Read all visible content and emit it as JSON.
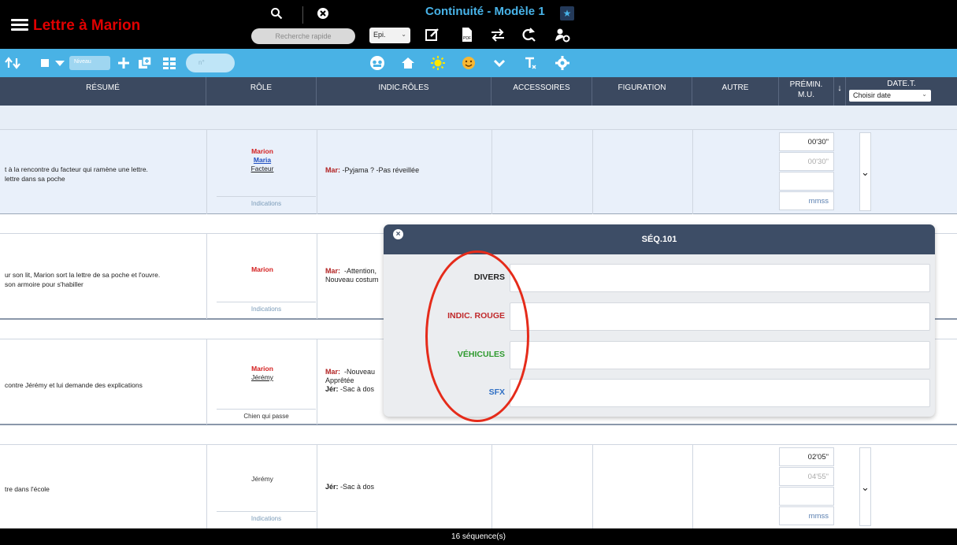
{
  "app": {
    "title": "Lettre à Marion",
    "model_title": "Continuité - Modèle 1",
    "search_placeholder": "Recherche rapide",
    "episode_select": "Epi.",
    "star_label": "★"
  },
  "toolbar2": {
    "level_label": "Niveau",
    "num_field": "n°"
  },
  "columns": {
    "resume": "RÉSUMÉ",
    "role": "RÔLE",
    "indic_roles": "INDIC.RÔLES",
    "accessoires": "ACCESSOIRES",
    "figuration": "FIGURATION",
    "autre": "AUTRE",
    "premin_line1": "PRÉMIN.",
    "premin_line2": "M.U.",
    "sort_arrow": "↓",
    "date_t": "DATE.T.",
    "date_select": "Choisir date"
  },
  "rows": [
    {
      "resume_line1": "t à la rencontre du facteur qui ramène une lettre.",
      "resume_line2": "lettre dans sa poche",
      "role1": "Marion",
      "role2": "Maria",
      "role3": "Facteur",
      "indic_label": "Mar:",
      "indic_text": "-Pyjama ? -Pas réveillée",
      "role_footer": "Indications",
      "time1": "00'30\"",
      "time2": "00'30\"",
      "time3": "mmss"
    },
    {
      "resume_line1": "ur son lit, Marion sort la lettre de sa poche et l'ouvre.",
      "resume_line2": "son armoire pour s'habiller",
      "role1": "Marion",
      "indic_label": "Mar:",
      "indic_text": "-Attention,",
      "indic_line2": "Nouveau costum",
      "role_footer": "Indications"
    },
    {
      "resume_line1": "contre Jérémy et lui demande des explications",
      "role1": "Marion",
      "role2": "Jérémy",
      "indic_label": "Mar:",
      "indic_text": "-Nouveau",
      "indic_line2": "Apprêtée",
      "indic_label2": "Jér:",
      "indic_text2": "-Sac à dos",
      "role_footer": "Chien qui passe"
    },
    {
      "resume_line1": "tre dans l'école",
      "role1": "Jérémy",
      "indic_label": "Jér:",
      "indic_text": "-Sac à dos",
      "role_footer": "Indications",
      "time1": "02'05\"",
      "time2": "04'55\"",
      "time3": "mmss"
    }
  ],
  "popup": {
    "title": "SÉQ.101",
    "close": "×",
    "fields": [
      {
        "label": "DIVERS",
        "color": "#222222"
      },
      {
        "label": "INDIC. ROUGE",
        "color": "#c0282a"
      },
      {
        "label": "VÉHICULES",
        "color": "#2e9a2e"
      },
      {
        "label": "SFX",
        "color": "#2f6fc4"
      }
    ]
  },
  "footer": {
    "count": "16 séquence(s)"
  },
  "colors": {
    "accent_blue": "#49b2e5",
    "header_navy": "#3b4960",
    "title_red": "#e00000",
    "annotation_red": "#e52b1a"
  }
}
